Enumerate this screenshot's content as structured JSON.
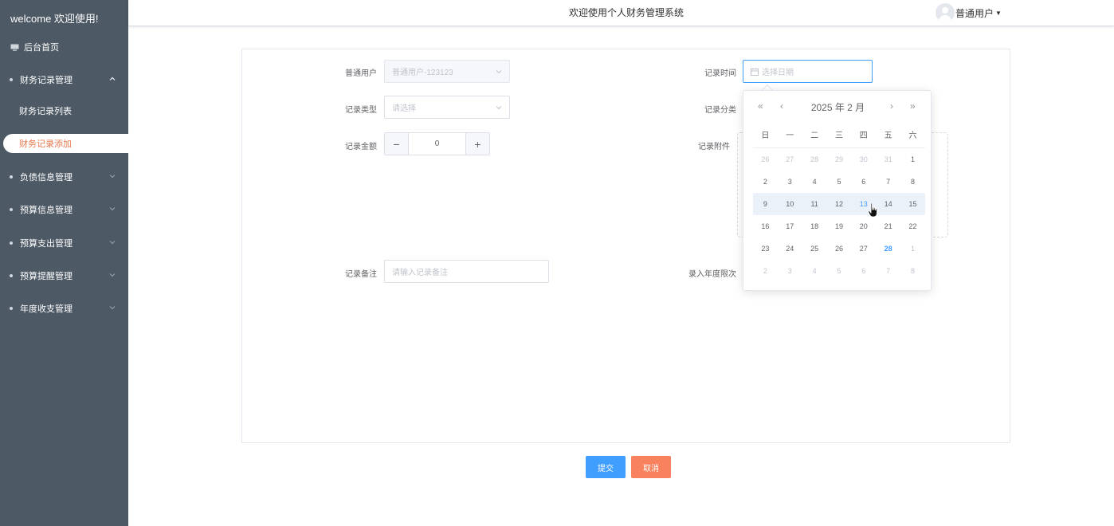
{
  "sidebar": {
    "welcome": "welcome 欢迎使用!",
    "home": "后台首页",
    "menus": [
      {
        "label": "财务记录管理",
        "expanded": true
      },
      {
        "label": "负债信息管理"
      },
      {
        "label": "预算信息管理"
      },
      {
        "label": "预算支出管理"
      },
      {
        "label": "预算提醒管理"
      },
      {
        "label": "年度收支管理"
      }
    ],
    "submenus": [
      {
        "label": "财务记录列表"
      },
      {
        "label": "财务记录添加",
        "active": true
      }
    ]
  },
  "header": {
    "title": "欢迎使用个人财务管理系统",
    "user": "普通用户"
  },
  "form": {
    "user_label": "普通用户",
    "user_value": "普通用户-123123",
    "time_label": "记录时间",
    "time_placeholder": "选择日期",
    "type_label": "记录类型",
    "type_placeholder": "请选择",
    "category_label": "记录分类",
    "amount_label": "记录金额",
    "amount_value": "0",
    "attachment_label": "记录附件",
    "note_label": "记录备注",
    "note_placeholder": "请输入记录备注",
    "year_label": "录入年度限次",
    "submit": "提交",
    "cancel": "取消"
  },
  "datepicker": {
    "year_month": "2025 年  2 月",
    "prev_year": "«",
    "prev_month": "‹",
    "next_month": "›",
    "next_year": "»",
    "weekdays": [
      "日",
      "一",
      "二",
      "三",
      "四",
      "五",
      "六"
    ],
    "weeks": [
      [
        {
          "d": "26",
          "m": true
        },
        {
          "d": "27",
          "m": true
        },
        {
          "d": "28",
          "m": true
        },
        {
          "d": "29",
          "m": true
        },
        {
          "d": "30",
          "m": true
        },
        {
          "d": "31",
          "m": true
        },
        {
          "d": "1"
        }
      ],
      [
        {
          "d": "2"
        },
        {
          "d": "3"
        },
        {
          "d": "4"
        },
        {
          "d": "5"
        },
        {
          "d": "6"
        },
        {
          "d": "7"
        },
        {
          "d": "8"
        }
      ],
      [
        {
          "d": "9"
        },
        {
          "d": "10"
        },
        {
          "d": "11"
        },
        {
          "d": "12"
        },
        {
          "d": "13",
          "s": true
        },
        {
          "d": "14"
        },
        {
          "d": "15"
        }
      ],
      [
        {
          "d": "16"
        },
        {
          "d": "17"
        },
        {
          "d": "18"
        },
        {
          "d": "19"
        },
        {
          "d": "20"
        },
        {
          "d": "21"
        },
        {
          "d": "22"
        }
      ],
      [
        {
          "d": "23"
        },
        {
          "d": "24"
        },
        {
          "d": "25"
        },
        {
          "d": "26"
        },
        {
          "d": "27"
        },
        {
          "d": "28",
          "t": true
        },
        {
          "d": "1",
          "m": true
        }
      ],
      [
        {
          "d": "2",
          "m": true
        },
        {
          "d": "3",
          "m": true
        },
        {
          "d": "4",
          "m": true
        },
        {
          "d": "5",
          "m": true
        },
        {
          "d": "6",
          "m": true
        },
        {
          "d": "7",
          "m": true
        },
        {
          "d": "8",
          "m": true
        }
      ]
    ],
    "highlighted_week": 2
  },
  "colors": {
    "sidebar_bg": "#4d5965",
    "active_text": "#e8794e",
    "primary": "#409eff",
    "cancel": "#f7825d"
  }
}
